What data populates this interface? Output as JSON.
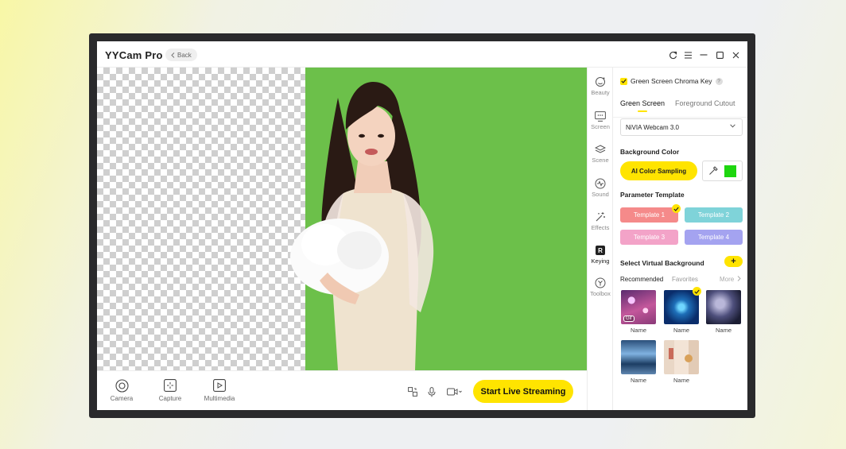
{
  "app": {
    "title": "YYCam Pro",
    "back_label": "Back",
    "window_controls": [
      "share-icon",
      "menu-icon",
      "minimize-icon",
      "maximize-icon",
      "close-icon"
    ]
  },
  "bottom_tools": [
    {
      "label": "Camera",
      "icon": "camera-icon"
    },
    {
      "label": "Capture",
      "icon": "capture-icon"
    },
    {
      "label": "Multimedia",
      "icon": "multimedia-icon"
    }
  ],
  "bottom_controls": [
    "screen-share-icon",
    "microphone-icon",
    "video-camera-icon"
  ],
  "stream_button": "Start Live Streaming",
  "rail": [
    {
      "label": "Beauty",
      "icon": "beauty-icon"
    },
    {
      "label": "Screen",
      "icon": "screen-icon"
    },
    {
      "label": "Scene",
      "icon": "scene-icon"
    },
    {
      "label": "Sound",
      "icon": "sound-icon"
    },
    {
      "label": "Effects",
      "icon": "effects-icon"
    },
    {
      "label": "Keying",
      "icon": "keying-icon",
      "active": true
    },
    {
      "label": "Toolbox",
      "icon": "toolbox-icon"
    }
  ],
  "panel": {
    "chroma_label": "Green Screen Chroma Key",
    "chroma_checked": true,
    "tabs": [
      "Green Screen",
      "Foreground Cutout"
    ],
    "active_tab": "Green Screen",
    "camera_select": "NiVIA Webcam 3.0",
    "bg_color_title": "Background Color",
    "ai_button": "AI Color Sampling",
    "selected_color": "#1ed60f",
    "param_title": "Parameter Template",
    "templates": [
      {
        "label": "Template 1",
        "color": "#f58a8a",
        "selected": true
      },
      {
        "label": "Template 2",
        "color": "#7fd3d9",
        "selected": false
      },
      {
        "label": "Template 3",
        "color": "#f3a3c8",
        "selected": false
      },
      {
        "label": "Template 4",
        "color": "#a4a3f0",
        "selected": false
      }
    ],
    "virtual_bg_title": "Select Virtual Background",
    "subtabs": [
      "Recommended",
      "Favorites"
    ],
    "more_label": "More",
    "backgrounds": [
      {
        "name": "Name",
        "badge": "Gif"
      },
      {
        "name": "Name",
        "selected": true
      },
      {
        "name": "Name"
      },
      {
        "name": "Name"
      },
      {
        "name": "Name"
      }
    ]
  },
  "colors": {
    "accent": "#ffe400",
    "green_screen": "#6cc04a"
  }
}
